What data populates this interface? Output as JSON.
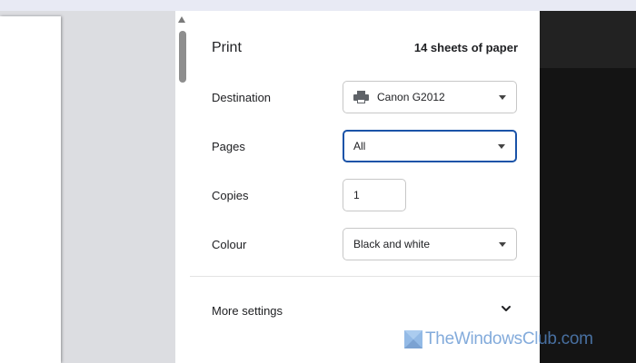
{
  "panel": {
    "title": "Print",
    "sheets": "14 sheets of paper"
  },
  "destination": {
    "label": "Destination",
    "value": "Canon G2012",
    "icon": "printer-icon"
  },
  "pages": {
    "label": "Pages",
    "value": "All"
  },
  "copies": {
    "label": "Copies",
    "value": "1"
  },
  "colour": {
    "label": "Colour",
    "value": "Black and white"
  },
  "more_settings": {
    "label": "More settings",
    "icon": "chevron-down-icon"
  },
  "watermark": {
    "text": "TheWindowsClub.com"
  },
  "colors": {
    "focus": "#1a53a8",
    "panel": "#ffffff",
    "preview": "#dcdde1",
    "dark": "#141414"
  }
}
